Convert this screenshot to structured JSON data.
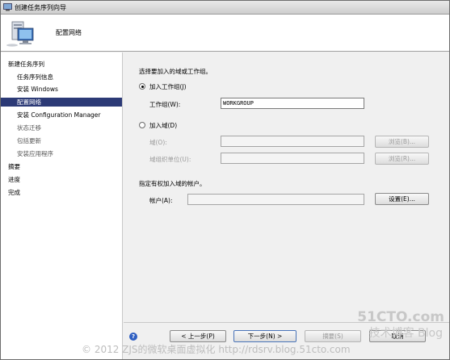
{
  "window": {
    "title": "创建任务序列向导"
  },
  "header": {
    "title": "配置网络"
  },
  "sidebar": {
    "items": [
      "新建任务序列",
      "任务序列信息",
      "安装 Windows",
      "配置网络",
      "安装 Configuration Manager",
      "状态迁移",
      "包括更新",
      "安装应用程序",
      "摘要",
      "进度",
      "完成"
    ]
  },
  "main": {
    "prompt": "选择要加入的域或工作组。",
    "workgroup_radio": "加入工作组(J)",
    "workgroup_label": "工作组(W):",
    "workgroup_value": "WORKGROUP",
    "domain_radio": "加入域(D)",
    "domain_label": "域(O):",
    "domain_browse": "浏览(B)...",
    "ou_label": "域组织单位(U):",
    "ou_browse": "浏览(R)...",
    "account_prompt": "指定有权加入域的帐户。",
    "account_label": "帐户(A):",
    "account_set": "设置(E)..."
  },
  "footer": {
    "back": "< 上一步(P)",
    "next": "下一步(N) >",
    "summary": "摘要(S)",
    "cancel": "取消"
  },
  "watermark": {
    "site": "51CTO.com",
    "tag": "技术博客 Blog",
    "credit": "© 2012 ZJS的微软桌面虚拟化 http://rdsrv.blog.51cto.com"
  },
  "colors": {
    "selection": "#2c3a76",
    "background": "#f0f0f0"
  }
}
